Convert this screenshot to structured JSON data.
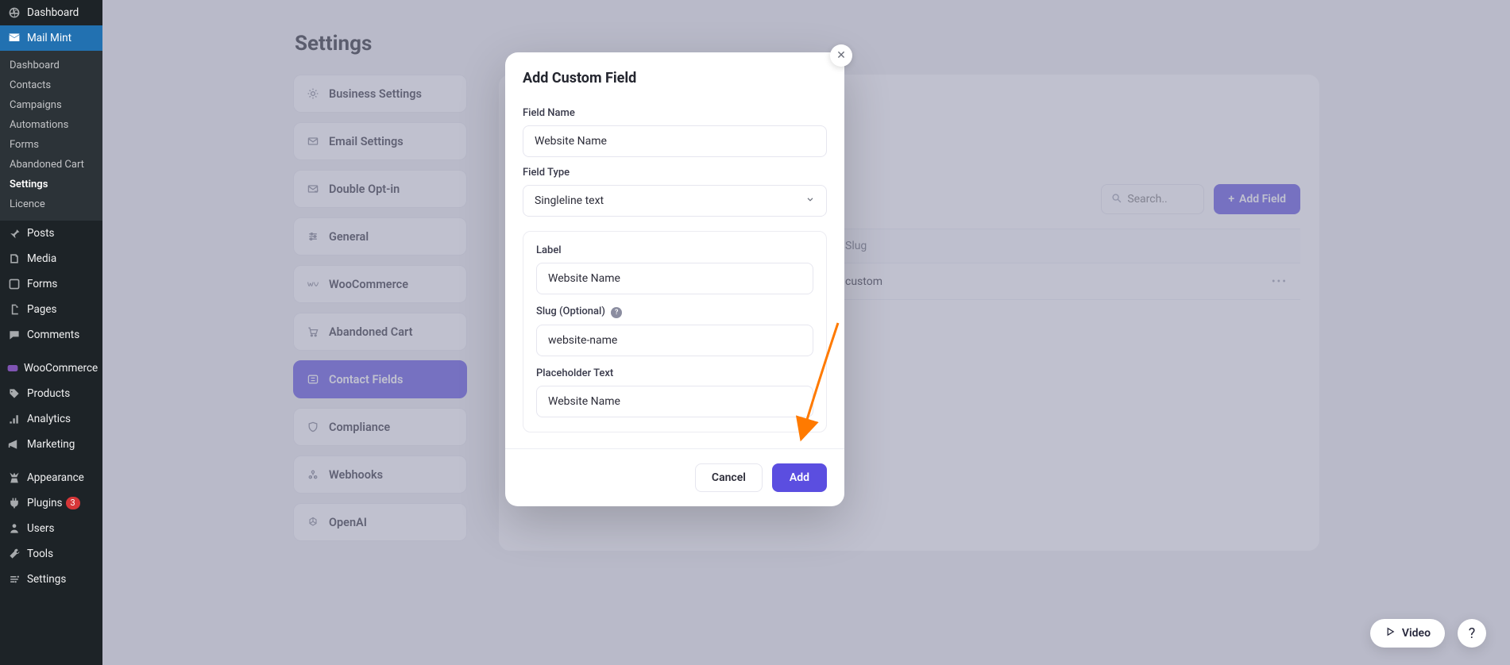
{
  "wp_sidebar": {
    "items": [
      {
        "label": "Dashboard"
      },
      {
        "label": "Mail Mint"
      },
      {
        "label": "Posts"
      },
      {
        "label": "Media"
      },
      {
        "label": "Forms"
      },
      {
        "label": "Pages"
      },
      {
        "label": "Comments"
      },
      {
        "label": "WooCommerce"
      },
      {
        "label": "Products"
      },
      {
        "label": "Analytics"
      },
      {
        "label": "Marketing"
      },
      {
        "label": "Appearance"
      },
      {
        "label": "Plugins"
      },
      {
        "label": "Users"
      },
      {
        "label": "Tools"
      },
      {
        "label": "Settings"
      }
    ],
    "plugins_badge": "3",
    "submenu": [
      "Dashboard",
      "Contacts",
      "Campaigns",
      "Automations",
      "Forms",
      "Abandoned Cart",
      "Settings",
      "Licence"
    ]
  },
  "page": {
    "title": "Settings"
  },
  "settings_nav": {
    "items": [
      "Business Settings",
      "Email Settings",
      "Double Opt-in",
      "General",
      "WooCommerce",
      "Abandoned Cart",
      "Contact Fields",
      "Compliance",
      "Webhooks",
      "OpenAI"
    ]
  },
  "panel": {
    "search_placeholder": "Search..",
    "add_field_label": "Add Field",
    "table": {
      "header_slug": "Slug",
      "row_slug": "custom"
    }
  },
  "modal": {
    "title": "Add Custom Field",
    "field_name_label": "Field Name",
    "field_name_value": "Website Name",
    "field_type_label": "Field Type",
    "field_type_value": "Singleline text",
    "label_label": "Label",
    "label_value": "Website Name",
    "slug_label": "Slug (Optional)",
    "slug_value": "website-name",
    "placeholder_label": "Placeholder Text",
    "placeholder_value": "Website Name",
    "cancel": "Cancel",
    "add": "Add"
  },
  "float": {
    "video": "Video"
  }
}
